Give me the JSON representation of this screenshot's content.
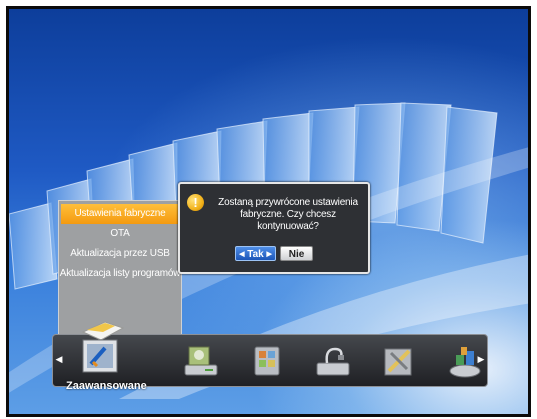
{
  "menu": {
    "items": [
      {
        "label": "Ustawienia fabryczne",
        "active": true
      },
      {
        "label": "OTA",
        "active": false
      },
      {
        "label": "Aktualizacja przez USB",
        "active": false
      },
      {
        "label": "Aktualizacja listy programów",
        "active": false
      }
    ]
  },
  "dialog": {
    "icon": "warning-icon",
    "icon_glyph": "!",
    "message_line1": "Zostaną przywrócone ustawienia",
    "message_line2": "fabryczne. Czy chcesz kontynuować?",
    "yes_label": "Tak",
    "no_label": "Nie"
  },
  "bottom_bar": {
    "selected_label": "Zaawansowane",
    "icons": [
      "advanced-settings-icon",
      "satellite-receiver-icon",
      "media-player-icon",
      "usb-device-icon",
      "tools-icon",
      "apps-icon"
    ]
  },
  "colors": {
    "menu_bg": "#9ea0a2",
    "menu_active": "#f49a10",
    "dialog_bg": "#2e3034",
    "yes_button": "#1c56b8",
    "background_blue": "#1f5ac4"
  }
}
